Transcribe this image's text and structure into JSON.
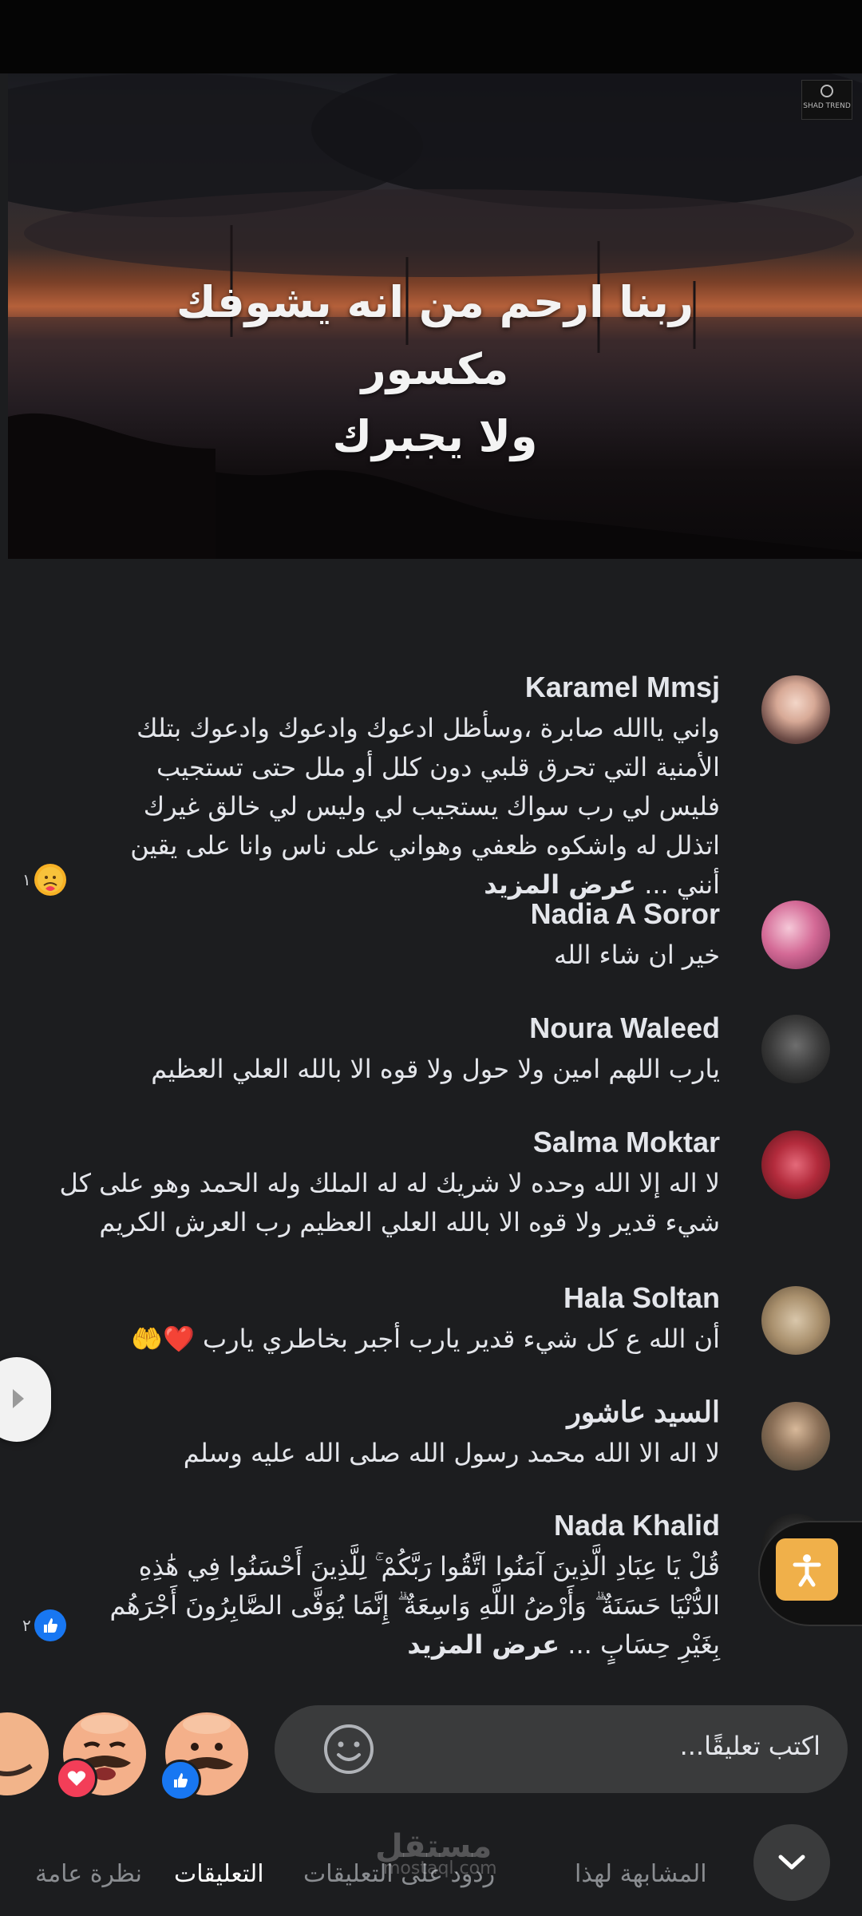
{
  "video": {
    "caption_line1": "ربنا ارحم من انه يشوفك مكسور",
    "caption_line2": "ولا يجبرك",
    "channel_logo": "SHAD TREND"
  },
  "comments": [
    {
      "name": "Karamel Mmsj",
      "lines": [
        "واني ياالله صابرة ،وسأظل  ادعوك وادعوك وادعوك بتلك",
        "الأمنية التي تحرق قلبي دون كلل أو ملل حتى تستجيب",
        "فليس لي  رب سواك يستجيب لي وليس لي خالق غيرك",
        "اتذلل له واشكوه ظعفي وهواني على ناس وانا على يقين",
        "أنني ..."
      ],
      "see_more": "عرض المزيد",
      "reaction": {
        "icon": "care-emoji-icon",
        "count": "١"
      }
    },
    {
      "name": "Nadia A Soror",
      "lines": [
        "خير ان شاء الله"
      ]
    },
    {
      "name": "Noura Waleed",
      "lines": [
        "يارب اللهم امين ولا حول ولا قوه الا بالله العلي العظيم"
      ]
    },
    {
      "name": "Salma Moktar",
      "lines": [
        "لا اله إلا الله وحده لا شريك له له الملك وله الحمد وهو على كل",
        "شيء قدير ولا قوه الا بالله العلي العظيم رب العرش الكريم"
      ]
    },
    {
      "name": "Hala Soltan",
      "lines": [
        "أن الله ع كل شيء قدير يارب أجبر بخاطري يارب ❤️🤲"
      ]
    },
    {
      "name": "السيد عاشور",
      "lines": [
        "لا اله الا الله محمد رسول الله صلى الله عليه وسلم"
      ]
    },
    {
      "name": "Nada Khalid",
      "lines": [
        "قُلْ يَا عِبَادِ الَّذِينَ آمَنُوا اتَّقُوا رَبَّكُمْ ۚ لِلَّذِينَ أَحْسَنُوا فِي هَٰذِهِ",
        "الدُّنْيَا حَسَنَةٌ ۗ وَأَرْضُ اللَّهِ وَاسِعَةٌ ۗ إِنَّمَا يُوَفَّى الصَّابِرُونَ أَجْرَهُم",
        "بِغَيْرِ حِسَابٍ ..."
      ],
      "see_more": "عرض المزيد",
      "reaction": {
        "icon": "like-icon",
        "count": "٢"
      }
    }
  ],
  "composer": {
    "placeholder": "اكتب تعليقًا..."
  },
  "tabs": [
    "المشابهة لهذا",
    "ردود على التعليقات",
    "التعليقات",
    "نظرة عامة"
  ],
  "active_tab": "التعليقات",
  "watermark": "مستقل",
  "watermark_sub": "mostaql.com",
  "colors": {
    "like_blue": "#1877f2",
    "love_red": "#f33e58",
    "accessibility": "#f0b04a"
  }
}
